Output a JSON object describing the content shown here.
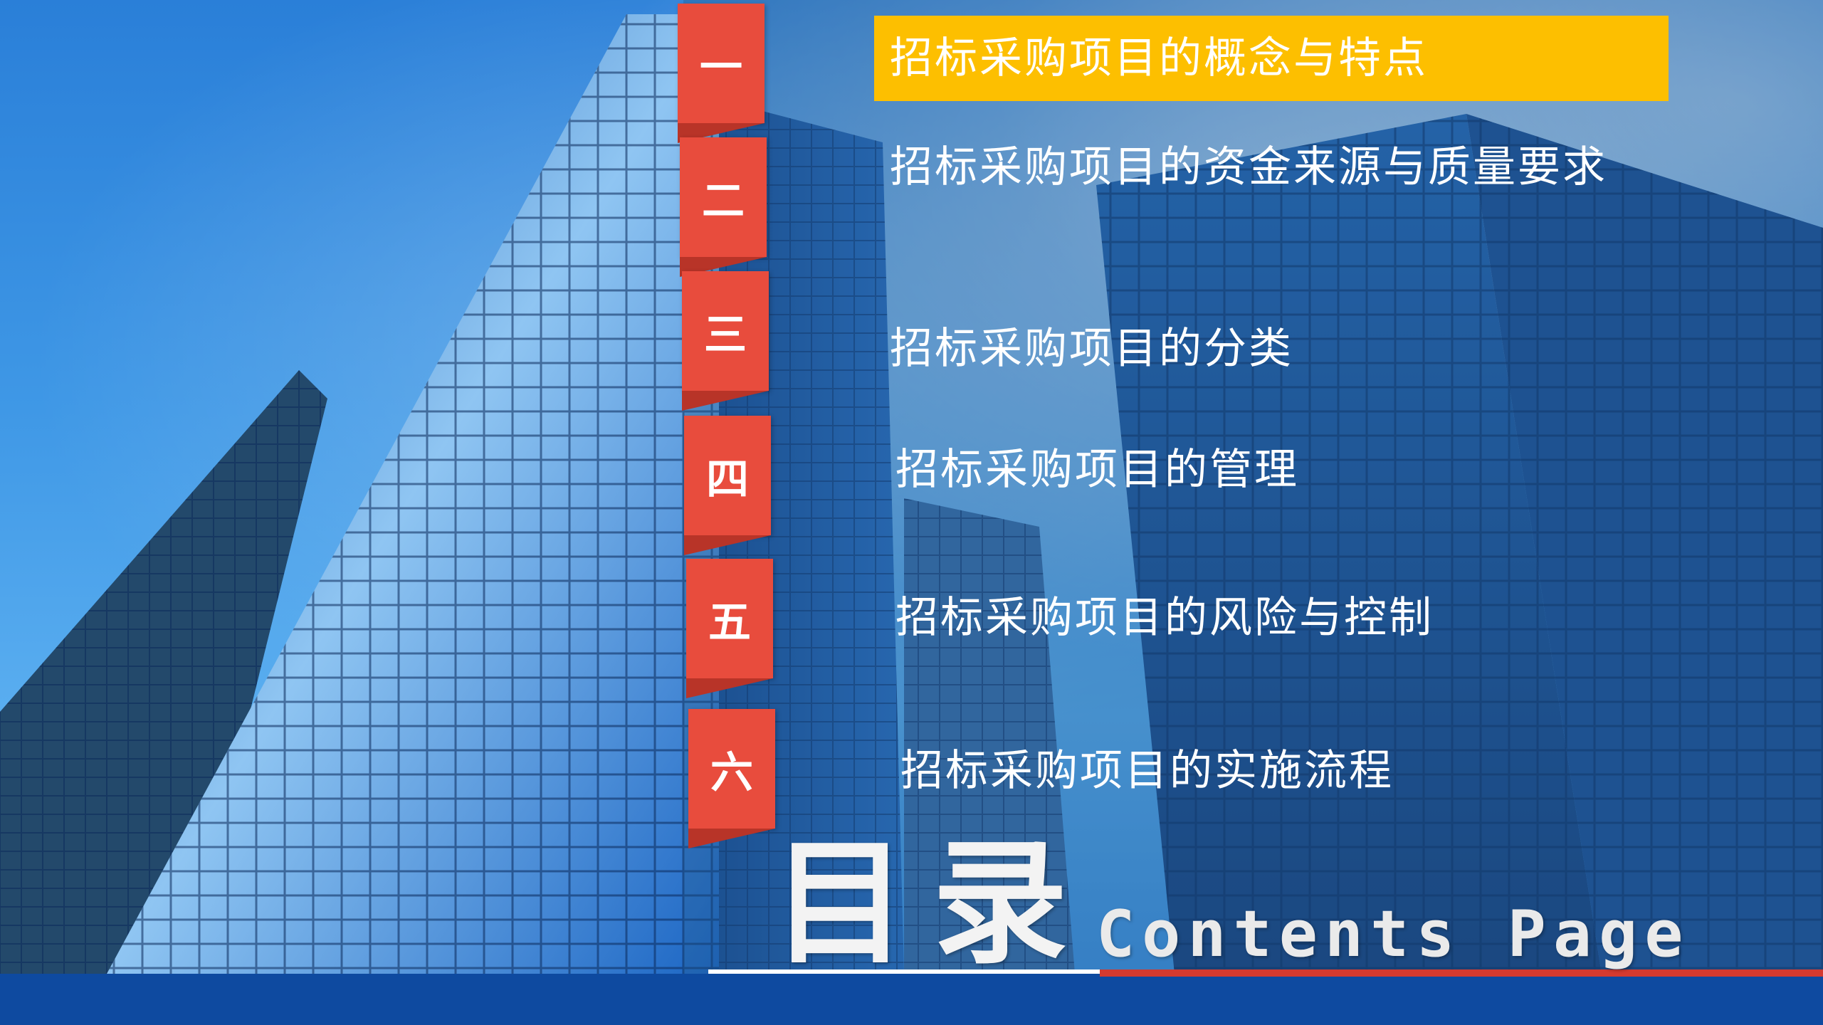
{
  "toc": {
    "items": [
      {
        "index": "一",
        "title": "招标采购项目的概念与特点"
      },
      {
        "index": "二",
        "title": "招标采购项目的资金来源与质量要求"
      },
      {
        "index": "三",
        "title": "招标采购项目的分类"
      },
      {
        "index": "四",
        "title": "招标采购项目的管理"
      },
      {
        "index": "五",
        "title": "招标采购项目的风险与控制"
      },
      {
        "index": "六",
        "title": "招标采购项目的实施流程"
      }
    ]
  },
  "heading": {
    "cn": "目录",
    "en": "Contents Page"
  },
  "colors": {
    "tab": "#e84c3d",
    "highlight": "#fdbf00",
    "bottom_bar": "#0e4aa0"
  }
}
